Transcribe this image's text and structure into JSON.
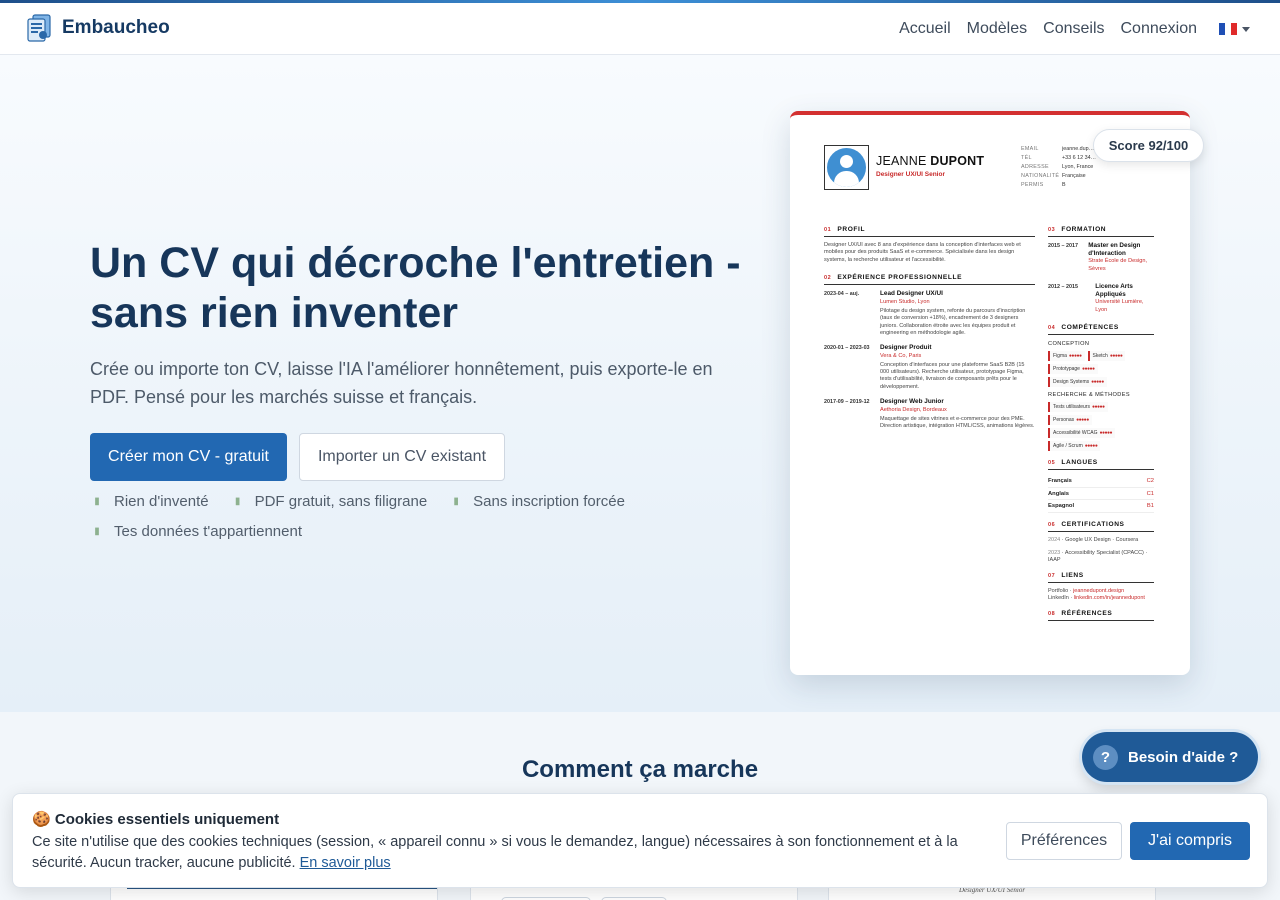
{
  "brand": {
    "name": "Embaucheo",
    "logo_icon": "document-stack-icon"
  },
  "nav": {
    "items": [
      "Accueil",
      "Modèles",
      "Conseils",
      "Connexion"
    ],
    "language_flag_icon": "flag-fr-icon",
    "flag_colors": [
      "#1f4fb5",
      "#ffffff",
      "#e02a2a"
    ]
  },
  "hero": {
    "title": "Un CV qui décroche l'entretien - sans rien inventer",
    "subtitle": "Crée ou importe ton CV, laisse l'IA l'améliorer honnêtement, puis exporte-le en PDF. Pensé pour les marchés suisse et français.",
    "cta_primary": "Créer mon CV - gratuit",
    "cta_secondary": "Importer un CV existant",
    "features": [
      "Rien d'inventé",
      "PDF gratuit, sans filigrane",
      "Sans inscription forcée",
      "Tes données t'appartiennent"
    ],
    "feature_icon": "check-icon"
  },
  "score": {
    "label": "Score 92/100"
  },
  "cv": {
    "first_name": "JEANNE",
    "last_name": "DUPONT",
    "role": "Designer UX/UI Senior",
    "contact": [
      {
        "key": "EMAIL",
        "value": "jeanne.dup…"
      },
      {
        "key": "TÉL",
        "value": "+33 6 12 34…"
      },
      {
        "key": "ADRESSE",
        "value": "Lyon, France"
      },
      {
        "key": "NATIONALITÉ",
        "value": "Française"
      },
      {
        "key": "PERMIS",
        "value": "B"
      }
    ],
    "profile": {
      "num": "01",
      "title": "PROFIL",
      "text": "Designer UX/UI avec 8 ans d'expérience dans la conception d'interfaces web et mobiles pour des produits SaaS et e-commerce. Spécialisée dans les design systems, la recherche utilisateur et l'accessibilité."
    },
    "experience": {
      "num": "02",
      "title": "EXPÉRIENCE PROFESSIONNELLE",
      "jobs": [
        {
          "dates": "2023-04 – auj.",
          "title": "Lead Designer UX/UI",
          "org": "Lumen Studio, Lyon",
          "desc": "Pilotage du design system, refonte du parcours d'inscription (taux de conversion +18%), encadrement de 3 designers juniors. Collaboration étroite avec les équipes produit et engineering en méthodologie agile."
        },
        {
          "dates": "2020-01 – 2023-03",
          "title": "Designer Produit",
          "org": "Vera & Co, Paris",
          "desc": "Conception d'interfaces pour une plateforme SaaS B2B (15 000 utilisateurs). Recherche utilisateur, prototypage Figma, tests d'utilisabilité, livraison de composants prêts pour le développement."
        },
        {
          "dates": "2017-09 – 2019-12",
          "title": "Designer Web Junior",
          "org": "Aethoria Design, Bordeaux",
          "desc": "Maquettage de sites vitrines et e-commerce pour des PME. Direction artistique, intégration HTML/CSS, animations légères."
        }
      ]
    },
    "education": {
      "num": "03",
      "title": "FORMATION",
      "items": [
        {
          "dates": "2015 – 2017",
          "title": "Master en Design d'Interaction",
          "org": "Strate École de Design, Sèvres"
        },
        {
          "dates": "2012 – 2015",
          "title": "Licence Arts Appliqués",
          "org": "Université Lumière, Lyon"
        }
      ]
    },
    "skills": {
      "num": "04",
      "title": "COMPÉTENCES",
      "cat1": "CONCEPTION",
      "cat2": "RECHERCHE & MÉTHODES",
      "dots": "●●●●●",
      "conception": [
        "Figma",
        "Sketch",
        "Prototypage",
        "Design Systems"
      ],
      "recherche": [
        "Tests utilisateurs",
        "Personas",
        "Accessibilité WCAG",
        "Agile / Scrum"
      ]
    },
    "languages": {
      "num": "05",
      "title": "LANGUES",
      "items": [
        {
          "name": "Français",
          "level": "C2"
        },
        {
          "name": "Anglais",
          "level": "C1"
        },
        {
          "name": "Espagnol",
          "level": "B1"
        }
      ]
    },
    "certifications": {
      "num": "06",
      "title": "CERTIFICATIONS",
      "items": [
        {
          "year": "2024",
          "text": " · Google UX Design · Coursera"
        },
        {
          "year": "2023",
          "text": " · Accessibility Specialist (CPACC) · IAAP"
        }
      ]
    },
    "links": {
      "num": "07",
      "title": "LIENS",
      "portfolio_label": "Portfolio · ",
      "portfolio_url": "jeannedupont.design",
      "linkedin_label": "LinkedIn · ",
      "linkedin_url": "linkedin.com/in/jeannedupont"
    },
    "references": {
      "num": "08",
      "title": "RÉFÉRENCES"
    }
  },
  "how": {
    "title": "Comment ça marche",
    "card_caption": "Designer UX/UI Senior"
  },
  "help": {
    "icon": "question-icon",
    "label": "Besoin d'aide ?"
  },
  "cookie": {
    "icon": "🍪",
    "title": "Cookies essentiels uniquement",
    "text": "Ce site n'utilise que des cookies techniques (session, « appareil connu » si vous le demandez, langue) nécessaires à son fonctionnement et à la sécurité. Aucun tracker, aucune publicité.",
    "link": "En savoir plus",
    "btn_pref": "Préférences",
    "btn_ok": "J'ai compris"
  },
  "colors": {
    "primary": "#2268b2",
    "navy": "#17365a",
    "accent_red": "#c82a2a"
  }
}
